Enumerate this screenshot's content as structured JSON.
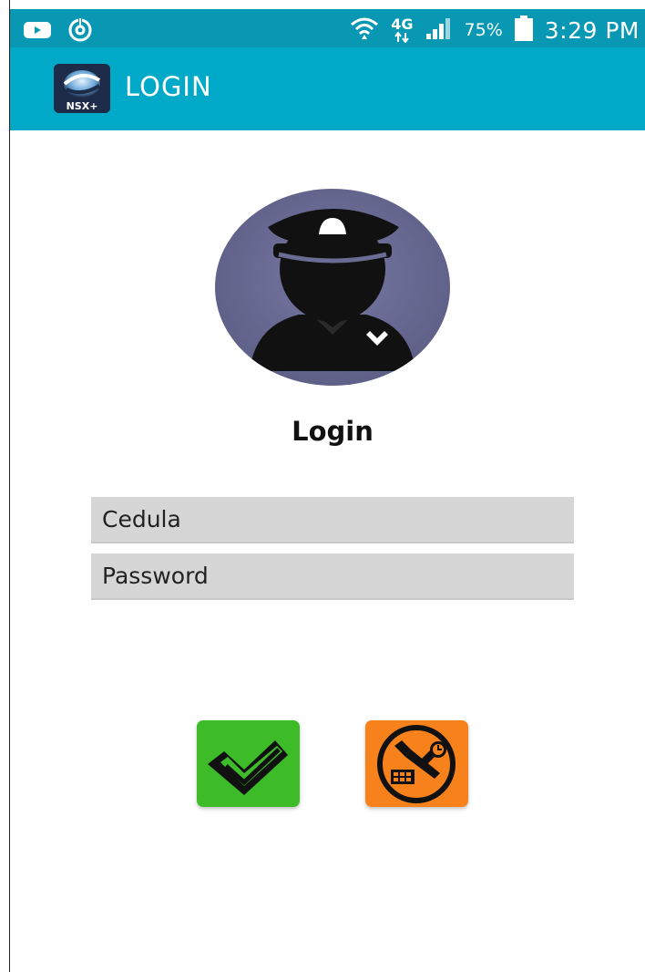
{
  "status_bar": {
    "battery_percent": "75%",
    "network": "4G",
    "time": "3:29 PM"
  },
  "app_bar": {
    "logo_text": "NSX+",
    "title": "LOGIN"
  },
  "main": {
    "heading": "Login",
    "cedula_placeholder": "Cedula",
    "cedula_value": "",
    "password_placeholder": "Password",
    "password_value": ""
  },
  "icons": {
    "status_left": [
      "youtube-icon",
      "sync-icon"
    ],
    "status_right": [
      "wifi-icon",
      "4g-icon",
      "signal-icon",
      "battery-icon"
    ],
    "avatar": "guard-avatar-icon",
    "accept": "check-icon",
    "settings": "tools-settings-icon"
  },
  "colors": {
    "status_bar": "#0898b3",
    "app_bar": "#00a9c8",
    "field_bg": "#d6d6d6",
    "accept_button": "#3dbb28",
    "settings_button": "#f7821b",
    "avatar_bg": "#6a6c94"
  }
}
